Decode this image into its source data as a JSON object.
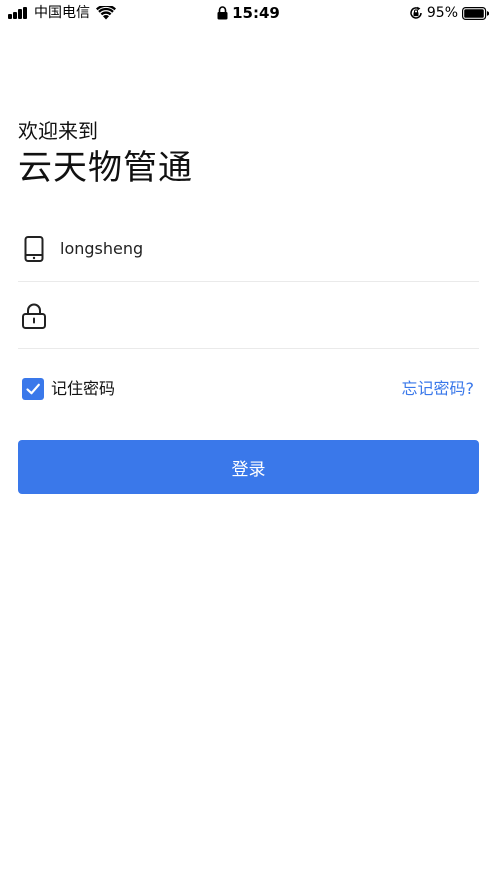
{
  "status_bar": {
    "carrier": "中国电信",
    "time": "15:49",
    "battery_percent": "95%",
    "icons": [
      "signal-icon",
      "wifi-icon",
      "lock-icon",
      "orientation-lock-icon",
      "battery-icon"
    ]
  },
  "header": {
    "welcome": "欢迎来到",
    "app_name": "云天物管通"
  },
  "form": {
    "username": {
      "icon": "phone-icon",
      "value": "longsheng",
      "placeholder": ""
    },
    "password": {
      "icon": "lock-icon",
      "value": "",
      "placeholder": ""
    },
    "remember": {
      "label": "记住密码",
      "checked": true
    },
    "forgot_label": "忘记密码?",
    "login_label": "登录"
  },
  "colors": {
    "accent": "#3a78ea",
    "text": "#111111",
    "divider": "#eaeaea",
    "background": "#ffffff"
  }
}
